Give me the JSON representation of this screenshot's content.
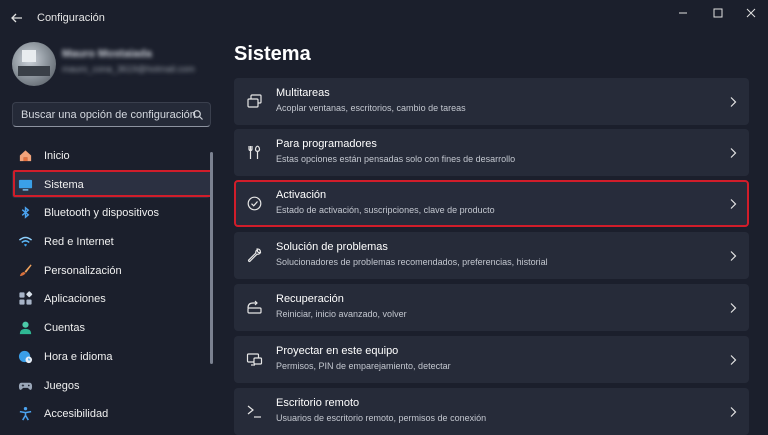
{
  "window": {
    "title": "Configuración"
  },
  "profile": {
    "name": "Mauro Mostaiada",
    "email": "mauro_cona_3619@hotmail.com"
  },
  "search": {
    "placeholder": "Buscar una opción de configuración"
  },
  "sidebar": {
    "items": [
      {
        "label": "Inicio",
        "icon": "home-icon"
      },
      {
        "label": "Sistema",
        "icon": "system-icon",
        "selected": true
      },
      {
        "label": "Bluetooth y dispositivos",
        "icon": "bluetooth-icon"
      },
      {
        "label": "Red e Internet",
        "icon": "wifi-icon"
      },
      {
        "label": "Personalización",
        "icon": "brush-icon"
      },
      {
        "label": "Aplicaciones",
        "icon": "apps-icon"
      },
      {
        "label": "Cuentas",
        "icon": "account-icon"
      },
      {
        "label": "Hora e idioma",
        "icon": "globe-clock-icon"
      },
      {
        "label": "Juegos",
        "icon": "gamepad-icon"
      },
      {
        "label": "Accesibilidad",
        "icon": "accessibility-icon"
      }
    ]
  },
  "main": {
    "title": "Sistema",
    "cards": [
      {
        "title": "Multitareas",
        "subtitle": "Acoplar ventanas, escritorios, cambio de tareas",
        "icon": "multitask-icon"
      },
      {
        "title": "Para programadores",
        "subtitle": "Estas opciones están pensadas solo con fines de desarrollo",
        "icon": "developer-tools-icon"
      },
      {
        "title": "Activación",
        "subtitle": "Estado de activación, suscripciones, clave de producto",
        "icon": "activation-check-icon"
      },
      {
        "title": "Solución de problemas",
        "subtitle": "Solucionadores de problemas recomendados, preferencias, historial",
        "icon": "wrench-icon"
      },
      {
        "title": "Recuperación",
        "subtitle": "Reiniciar, inicio avanzado, volver",
        "icon": "recovery-icon"
      },
      {
        "title": "Proyectar en este equipo",
        "subtitle": "Permisos, PIN de emparejamiento, detectar",
        "icon": "project-icon"
      },
      {
        "title": "Escritorio remoto",
        "subtitle": "Usuarios de escritorio remoto, permisos de conexión",
        "icon": "remote-desktop-icon"
      }
    ]
  },
  "colors": {
    "background": "#1b1f2c",
    "card": "#262b39",
    "highlight": "#d11d2a"
  }
}
